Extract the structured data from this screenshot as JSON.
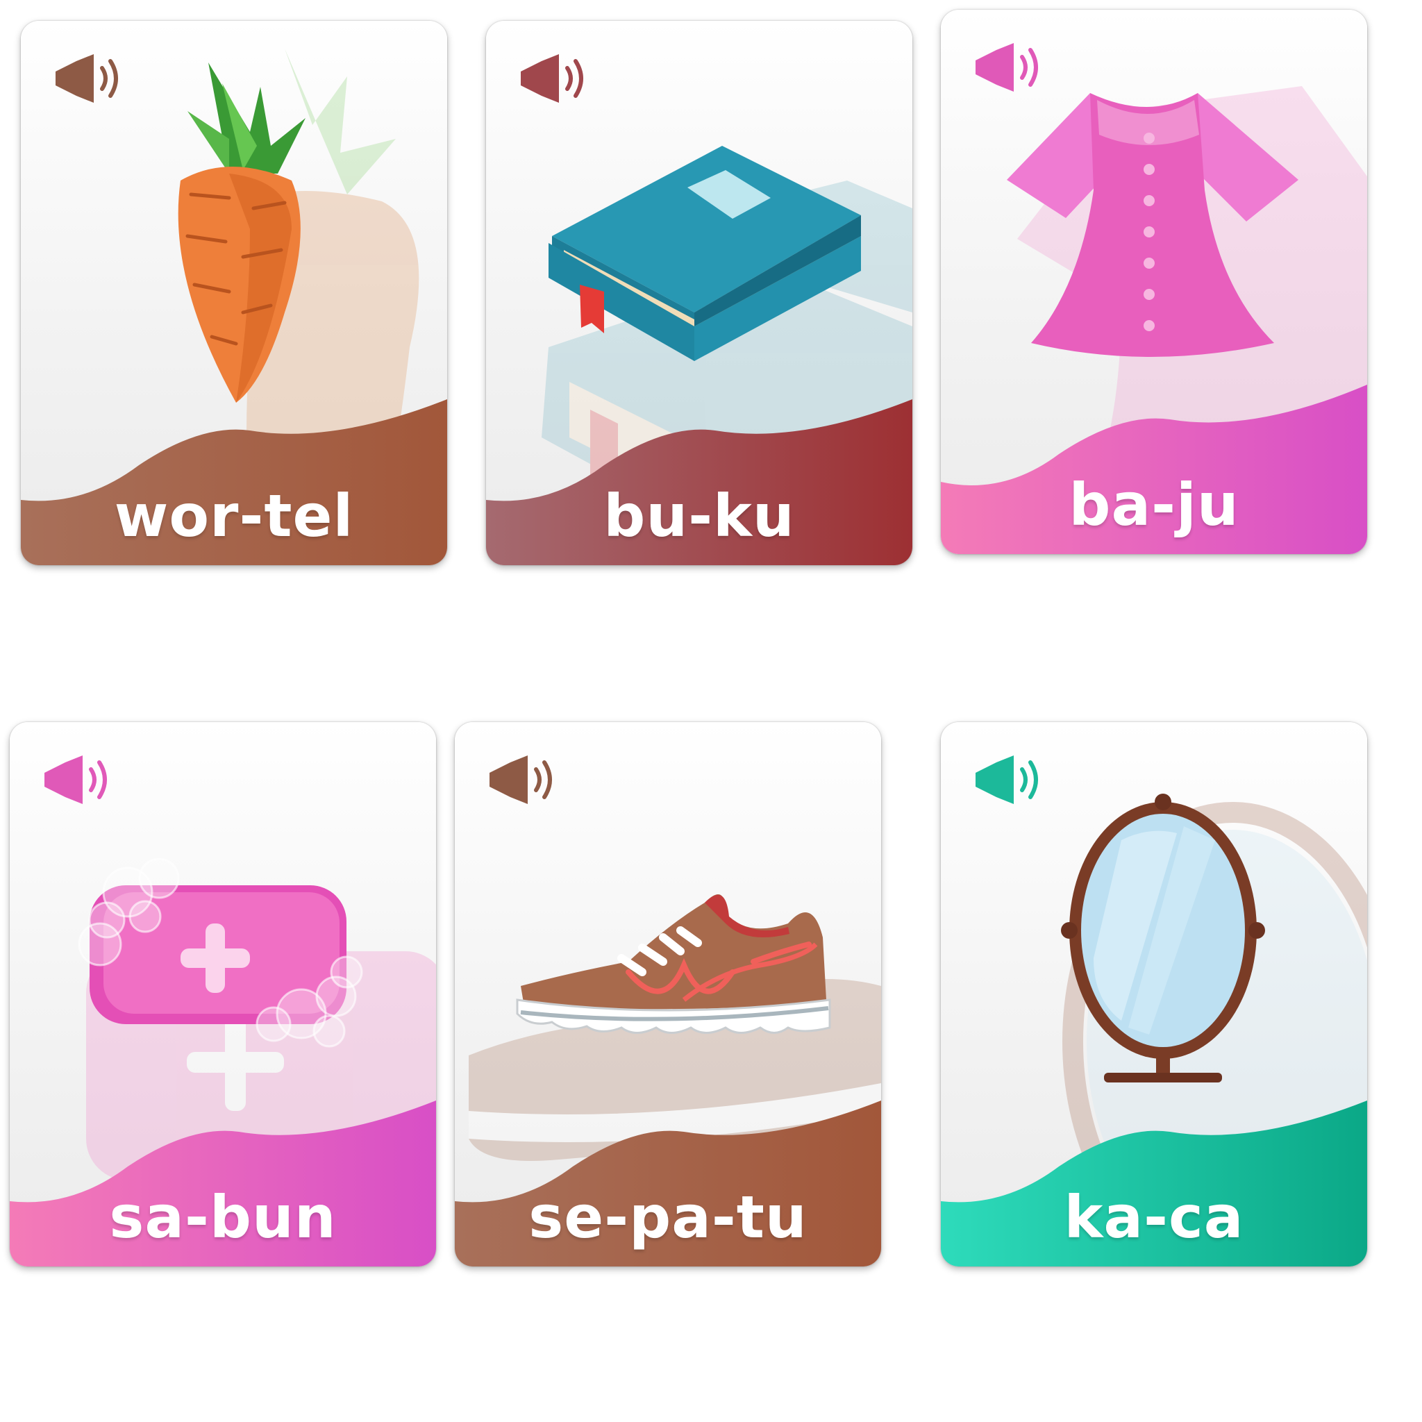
{
  "cards": [
    {
      "word": "wor-tel",
      "icon": "carrot-icon",
      "theme": "brown",
      "color_start": "#a8705a",
      "color_end": "#a2573a",
      "speaker_color": "#8e5a45"
    },
    {
      "word": "bu-ku",
      "icon": "book-icon",
      "theme": "maroon",
      "color_start": "#a56a70",
      "color_end": "#9d3033",
      "speaker_color": "#a0474c"
    },
    {
      "word": "ba-ju",
      "icon": "dress-icon",
      "theme": "pink",
      "color_start": "#f47bb7",
      "color_end": "#d84fc6",
      "speaker_color": "#e059b8"
    },
    {
      "word": "sa-bun",
      "icon": "soap-icon",
      "theme": "pink",
      "color_start": "#f47bb7",
      "color_end": "#d84fc6",
      "speaker_color": "#e059b8"
    },
    {
      "word": "se-pa-tu",
      "icon": "shoe-icon",
      "theme": "brown",
      "color_start": "#a8705a",
      "color_end": "#a2573a",
      "speaker_color": "#8e5a45"
    },
    {
      "word": "ka-ca",
      "icon": "mirror-icon",
      "theme": "teal",
      "color_start": "#2edbbb",
      "color_end": "#0ba887",
      "speaker_color": "#1cb99a"
    }
  ],
  "speaker_icon": "speaker-icon"
}
